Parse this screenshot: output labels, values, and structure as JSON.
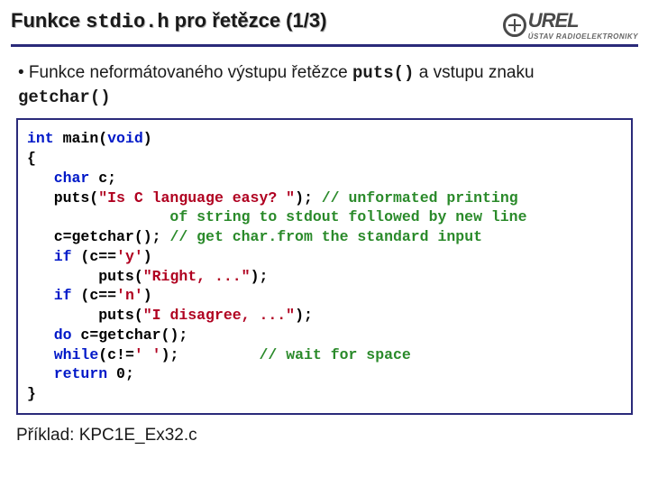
{
  "header": {
    "title_pre": "Funkce ",
    "title_mono": "stdio.h",
    "title_post": " pro řetězce (1/3)",
    "logo_text": "UREL",
    "logo_sub": "ÚSTAV RADIOELEKTRONIKY"
  },
  "bullet": {
    "lead": "•  Funkce neformátovaného výstupu řetězce ",
    "code1": "puts()",
    "mid": " a vstupu znaku ",
    "code2": "getchar()"
  },
  "code": {
    "l1_a": "int",
    "l1_b": " main(",
    "l1_c": "void",
    "l1_d": ")",
    "l2": "{",
    "l3_a": "   ",
    "l3_b": "char",
    "l3_c": " c;",
    "l4_a": "   puts(",
    "l4_b": "\"Is C language easy? \"",
    "l4_c": "); ",
    "l4_d": "// unformated printing",
    "l5": "                of string to stdout followed by new line",
    "l6_a": "   c=getchar(); ",
    "l6_b": "// get char.from the standard input",
    "l7_a": "   ",
    "l7_b": "if",
    "l7_c": " (c==",
    "l7_d": "'y'",
    "l7_e": ")",
    "l8_a": "        puts(",
    "l8_b": "\"Right, ...\"",
    "l8_c": ");",
    "l9_a": "   ",
    "l9_b": "if",
    "l9_c": " (c==",
    "l9_d": "'n'",
    "l9_e": ")",
    "l10_a": "        puts(",
    "l10_b": "\"I disagree, ...\"",
    "l10_c": ");",
    "l11_a": "   ",
    "l11_b": "do",
    "l11_c": " c=getchar();",
    "l12_a": "   ",
    "l12_b": "while",
    "l12_c": "(c!=",
    "l12_d": "' '",
    "l12_e": ");         ",
    "l12_f": "// wait for space",
    "l13_a": "   ",
    "l13_b": "return",
    "l13_c": " 0;",
    "l14": "}"
  },
  "footer": {
    "text": "Příklad: KPC1E_Ex32.c"
  }
}
